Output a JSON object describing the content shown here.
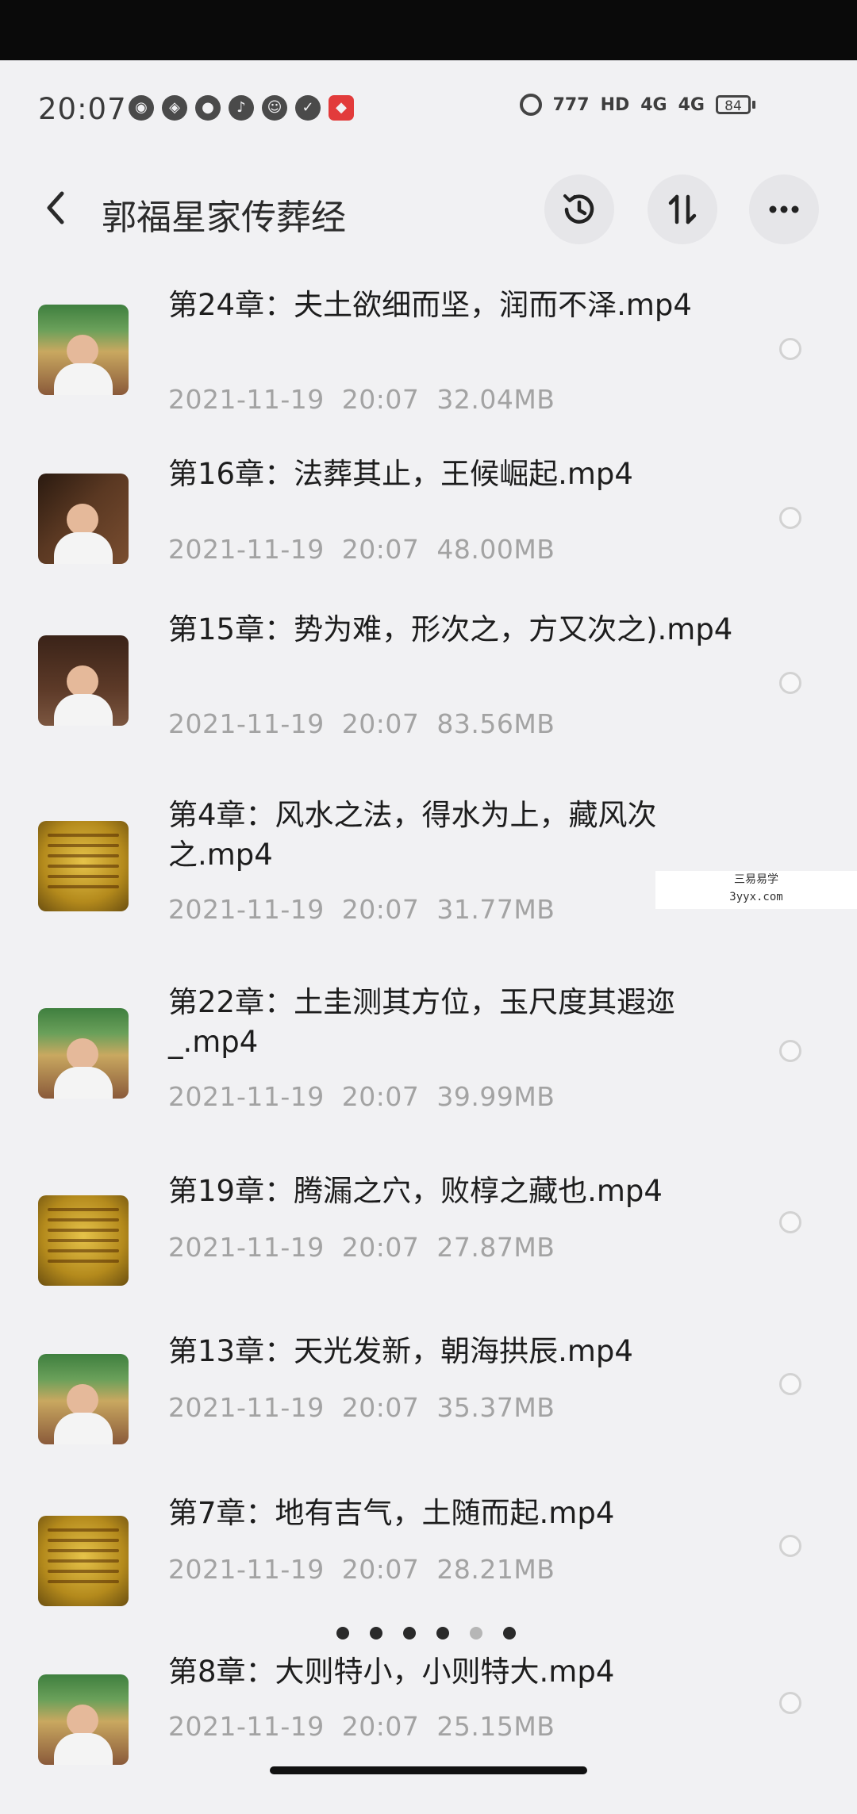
{
  "status_bar": {
    "time": "20:07",
    "network": "4G",
    "hd": "HD",
    "signal_speed": "777",
    "battery": "84"
  },
  "header": {
    "title": "郭福星家传葬经",
    "history_icon": "history-icon",
    "sort_icon": "sort-icon",
    "more_icon": "more-icon"
  },
  "files": [
    {
      "name": "第24章：夫土欲细而坚，润而不泽.mp4",
      "date": "2021-11-19",
      "time": "20:07",
      "size": "32.04MB",
      "thumb": "person"
    },
    {
      "name": "第16章：法葬其止，王候崛起.mp4",
      "date": "2021-11-19",
      "time": "20:07",
      "size": "48.00MB",
      "thumb": "person2"
    },
    {
      "name": "第15章：势为难，形次之，方又次之).mp4",
      "date": "2021-11-19",
      "time": "20:07",
      "size": "83.56MB",
      "thumb": "person3"
    },
    {
      "name": "第4章：风水之法，得水为上，藏风次之.mp4",
      "date": "2021-11-19",
      "time": "20:07",
      "size": "31.77MB",
      "thumb": "yellow"
    },
    {
      "name": "第22章：土圭测其方位，玉尺度其遐迩_.mp4",
      "date": "2021-11-19",
      "time": "20:07",
      "size": "39.99MB",
      "thumb": "person"
    },
    {
      "name": "第19章：腾漏之穴，败椁之藏也.mp4",
      "date": "2021-11-19",
      "time": "20:07",
      "size": "27.87MB",
      "thumb": "yellow"
    },
    {
      "name": "第13章：天光发新，朝海拱辰.mp4",
      "date": "2021-11-19",
      "time": "20:07",
      "size": "35.37MB",
      "thumb": "person"
    },
    {
      "name": "第7章：地有吉气，土随而起.mp4",
      "date": "2021-11-19",
      "time": "20:07",
      "size": "28.21MB",
      "thumb": "yellow"
    },
    {
      "name": "第8章：大则特小，小则特大.mp4",
      "date": "2021-11-19",
      "time": "20:07",
      "size": "25.15MB",
      "thumb": "person"
    }
  ],
  "watermark": {
    "line1": "三易易学",
    "line2": "3yyx.com"
  }
}
